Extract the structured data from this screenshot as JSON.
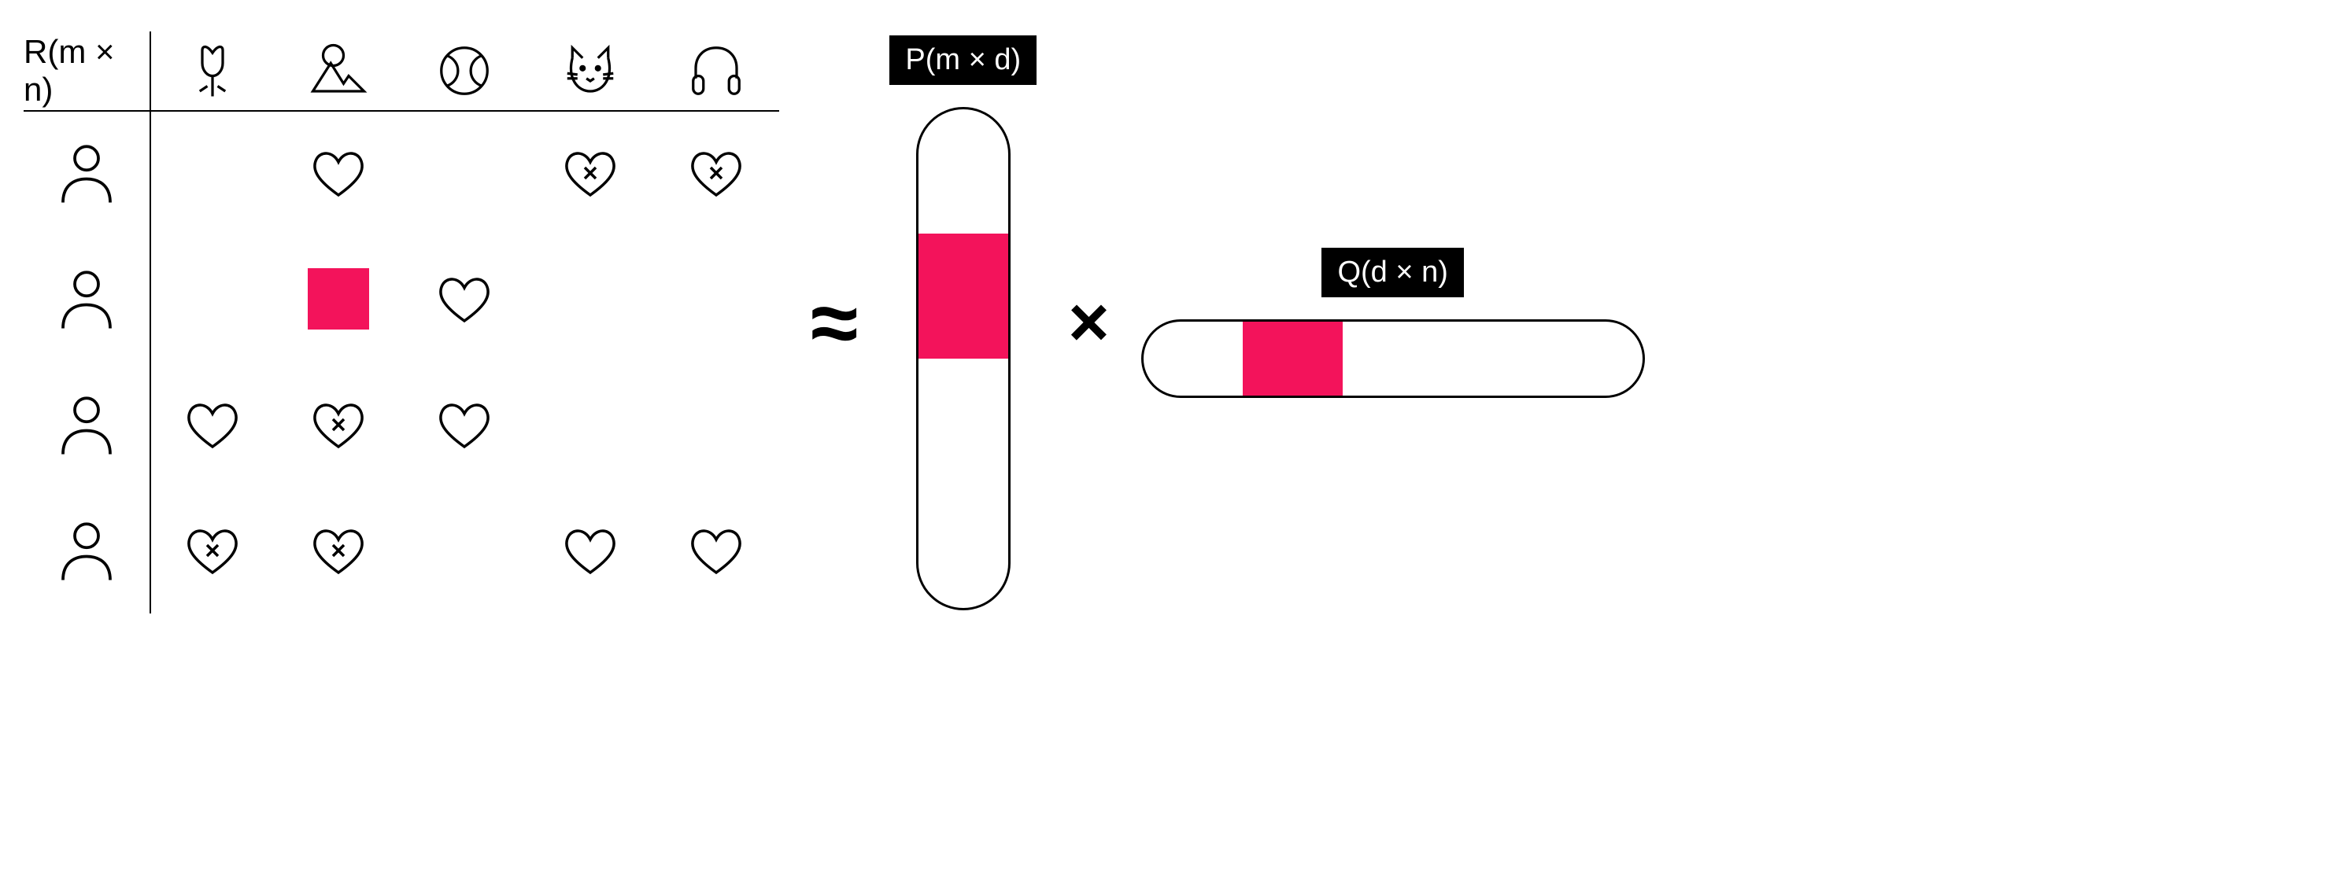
{
  "labels": {
    "R": "R(m × n)",
    "P": "P(m × d)",
    "Q": "Q(d × n)",
    "approx": "≈",
    "times": "×"
  },
  "columns": [
    "tulip",
    "mountain",
    "ball",
    "cat",
    "headphones"
  ],
  "rows": [
    "user1",
    "user2",
    "user3",
    "user4"
  ],
  "grid": [
    [
      "",
      "heart",
      "",
      "heart-x",
      "heart-x"
    ],
    [
      "",
      "pink-sq",
      "heart",
      "",
      ""
    ],
    [
      "heart",
      "heart-x",
      "heart",
      "",
      ""
    ],
    [
      "heart-x",
      "heart-x",
      "",
      "heart",
      "heart"
    ]
  ],
  "palette": {
    "accent": "#f3135b"
  },
  "P_highlight": {
    "row_index": 1,
    "total_rows": 4
  },
  "Q_highlight": {
    "col_index": 1,
    "total_cols": 5
  }
}
